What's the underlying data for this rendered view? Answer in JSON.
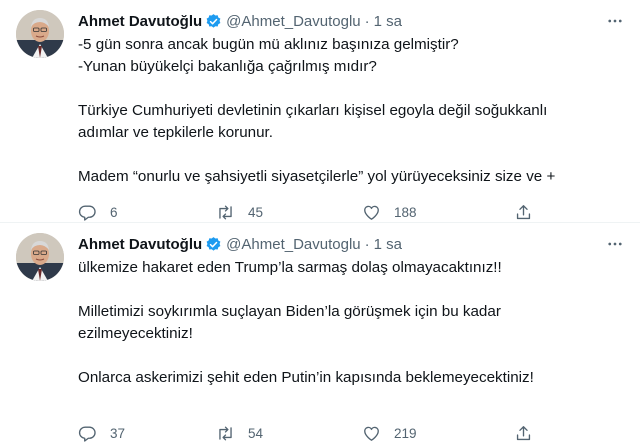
{
  "colors": {
    "verified": "#1d9bf0",
    "text": "#0f1419",
    "muted": "#536471",
    "divider": "#eff3f4"
  },
  "icons": {
    "verified": "verified-badge-icon",
    "more": "more-horizontal-icon",
    "reply": "reply-icon",
    "retweet": "retweet-icon",
    "like": "heart-icon",
    "share": "share-icon"
  },
  "tweets": [
    {
      "author": {
        "name": "Ahmet Davutoğlu",
        "handle": "@Ahmet_Davutoglu"
      },
      "separator": "·",
      "time": "1 sa",
      "lines": [
        "-5 gün sonra ancak bugün mü aklınız başınıza gelmiştir?",
        "-Yunan büyükelçi bakanlığa çağrılmış mıdır?",
        "",
        "Türkiye Cumhuriyeti devletinin çıkarları kişisel egoyla değil soğukkanlı",
        "adımlar ve tepkilerle korunur.",
        "",
        "Madem “onurlu ve şahsiyetli siyasetçilerle” yol yürüyeceksiniz size ve +"
      ],
      "stats": {
        "replies": "6",
        "retweets": "45",
        "likes": "188"
      }
    },
    {
      "author": {
        "name": "Ahmet Davutoğlu",
        "handle": "@Ahmet_Davutoglu"
      },
      "separator": "·",
      "time": "1 sa",
      "lines": [
        "ülkemize hakaret eden Trump’la sarmaş dolaş olmayacaktınız!!",
        "",
        "Milletimizi soykırımla suçlayan Biden’la görüşmek için bu kadar",
        "ezilmeyecektiniz!",
        "",
        "Onlarca askerimizi şehit eden Putin’in kapısında beklemeyecektiniz!"
      ],
      "stats": {
        "replies": "37",
        "retweets": "54",
        "likes": "219"
      }
    }
  ]
}
